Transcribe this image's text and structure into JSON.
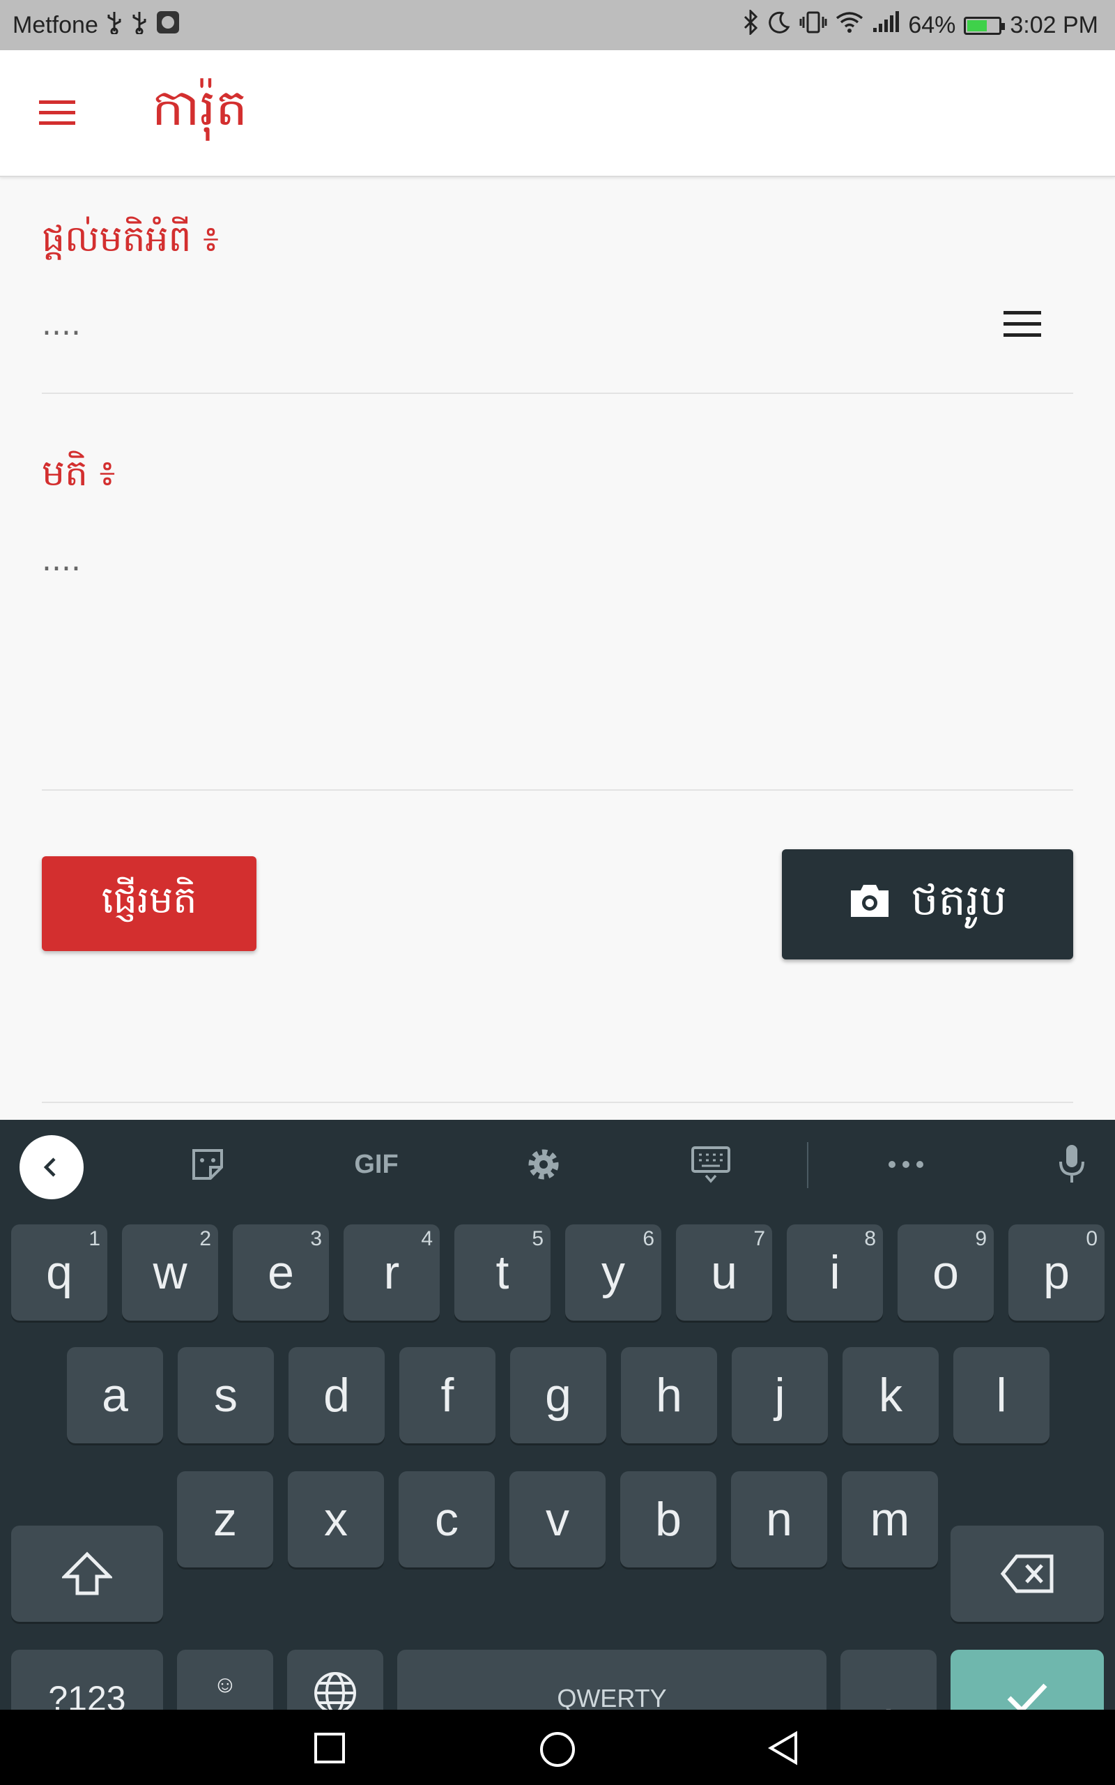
{
  "status_bar": {
    "carrier": "Metfone",
    "battery_percent": "64%",
    "battery_level": 0.64,
    "time": "3:02 PM",
    "icons_left": [
      "usb-icon",
      "usb-icon",
      "app-notification-icon"
    ],
    "icons_right": [
      "bluetooth-icon",
      "do-not-disturb-icon",
      "vibrate-icon",
      "wifi-icon",
      "signal-icon",
      "battery-charging-icon"
    ]
  },
  "app_bar": {
    "menu_icon": "hamburger-menu-icon",
    "title": "ការ៉ុត"
  },
  "form": {
    "topic_label": "ផ្តល់មតិអំពី ៖",
    "topic_value": "....",
    "topic_picker_icon": "list-menu-icon",
    "comment_label": "មតិ ៖",
    "comment_placeholder": "....",
    "send_button": "ផ្ញើរមតិ",
    "photo_button": "ថតរូប",
    "photo_icon": "camera-icon"
  },
  "keyboard": {
    "toolbar_icons": [
      "back-icon",
      "sticker-icon",
      "gif-icon",
      "settings-icon",
      "keyboard-icon",
      "more-icon",
      "microphone-icon"
    ],
    "gif_label": "GIF",
    "row1": [
      "q",
      "w",
      "e",
      "r",
      "t",
      "y",
      "u",
      "i",
      "o",
      "p"
    ],
    "row1_hints": [
      "1",
      "2",
      "3",
      "4",
      "5",
      "6",
      "7",
      "8",
      "9",
      "0"
    ],
    "row2": [
      "a",
      "s",
      "d",
      "f",
      "g",
      "h",
      "j",
      "k",
      "l"
    ],
    "row3": [
      "z",
      "x",
      "c",
      "v",
      "b",
      "n",
      "m"
    ],
    "symbols_key": "?123",
    "comma_key": ",",
    "emoji_hint": "☺",
    "space_label": "QWERTY",
    "period_key": "."
  },
  "nav_bar": {
    "icons": [
      "recent-apps-icon",
      "home-icon",
      "back-nav-icon"
    ]
  },
  "colors": {
    "accent": "#d32f2f",
    "dark_button": "#263238",
    "keyboard_bg": "#263238",
    "key_bg": "#3f4b52",
    "enter_key": "#6fb7ad"
  }
}
